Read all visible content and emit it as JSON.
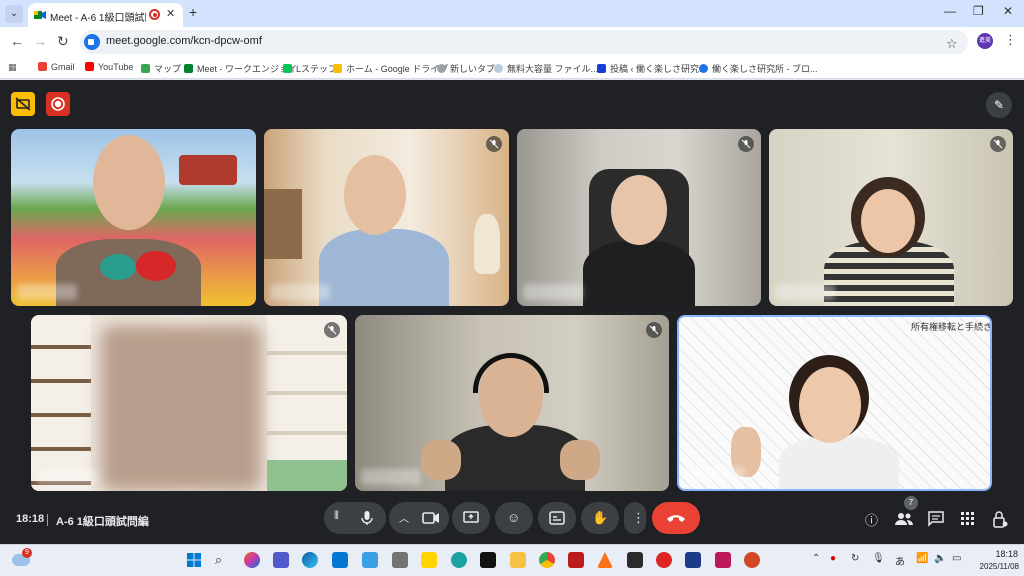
{
  "browser": {
    "tab_title": "Meet - A-6 1級口頭試問編",
    "url": "meet.google.com/kcn-dpcw-omf",
    "profile_label": "進美",
    "bookmarks": [
      "Gmail",
      "YouTube",
      "マップ",
      "Meet - ワークエンジョイ",
      "Lステップ",
      "ホーム - Google ドライブ",
      "新しいタブ",
      "無料大容量 ファイル...",
      "投稿 ‹ 働く楽しさ研究...",
      "働く楽しさ研究所 - ブロ..."
    ]
  },
  "meet": {
    "time": "18:18",
    "meeting_name": "A-6 1級口頭試問編",
    "participant_count": "7",
    "colors": {
      "end_call": "#ea4335",
      "record": "#d93025",
      "captions_off": "#f9ab00"
    }
  },
  "overlay_text": "所有権移転と手続き",
  "taskbar": {
    "weather_badge": "9",
    "time": "18:18",
    "date": "2025/11/08",
    "ime": "あ"
  }
}
